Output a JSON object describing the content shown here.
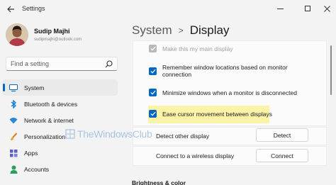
{
  "window": {
    "title": "Settings",
    "back_icon": "back-arrow-icon",
    "controls": [
      "minimize-icon",
      "maximize-icon",
      "close-icon"
    ]
  },
  "user": {
    "name": "Sudip Majhi",
    "email": "sudipmajhi@outlook.com"
  },
  "search": {
    "placeholder": "Find a setting",
    "value": ""
  },
  "sidebar": {
    "items": [
      {
        "label": "System",
        "icon": "system-icon",
        "active": true
      },
      {
        "label": "Bluetooth & devices",
        "icon": "bluetooth-icon",
        "active": false
      },
      {
        "label": "Network & internet",
        "icon": "wifi-icon",
        "active": false
      },
      {
        "label": "Personalization",
        "icon": "brush-icon",
        "active": false
      },
      {
        "label": "Apps",
        "icon": "apps-icon",
        "active": false
      },
      {
        "label": "Accounts",
        "icon": "accounts-icon",
        "active": false
      }
    ]
  },
  "breadcrumb": {
    "parent": "System",
    "separator": ">",
    "current": "Display"
  },
  "options": [
    {
      "label": "Make this my main display",
      "checked": true,
      "disabled": true
    },
    {
      "label": "Remember window locations based on monitor connection",
      "checked": true,
      "disabled": false
    },
    {
      "label": "Minimize windows when a monitor is disconnected",
      "checked": true,
      "disabled": false
    },
    {
      "label": "Ease cursor movement between displays",
      "checked": true,
      "disabled": false,
      "highlighted": true
    }
  ],
  "detect": {
    "label": "Detect other display",
    "button": "Detect"
  },
  "connect": {
    "label": "Connect to a wireless display",
    "button": "Connect"
  },
  "section": {
    "title": "Brightness & color"
  },
  "watermark": {
    "text": "TheWindowsClub"
  },
  "colors": {
    "accent": "#0067c0",
    "highlight": "#fbf3a8",
    "background": "#f3f3f3"
  }
}
